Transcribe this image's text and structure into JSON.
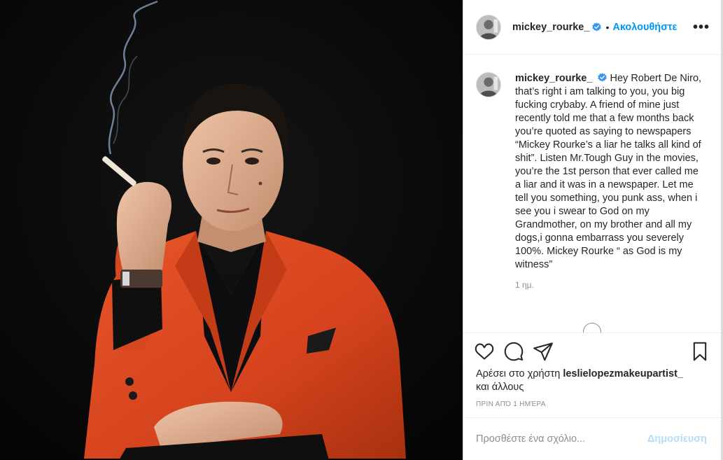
{
  "header": {
    "username": "mickey_rourke_",
    "separator": "•",
    "follow_label": "Ακολουθήστε",
    "more_label": "•••"
  },
  "caption": {
    "username": "mickey_rourke_",
    "text": "Hey Robert De Niro, that’s right i am talking to you, you big fucking crybaby. A friend of mine just recently told me that a few months back you’re quoted as saying to newspapers “Mickey Rourke’s a liar he talks all kind of shit”. Listen Mr.Tough Guy in the movies, you’re the 1st person that ever called me a liar and it was in a newspaper. Let me tell you something, you punk ass, when i see you i swear to God on my Grandmother, on my brother and all my dogs,i gonna embarrass you severely 100%. Mickey Rourke “ as God is my witness”",
    "time": "1 ημ."
  },
  "likes": {
    "prefix": "Αρέσει στο χρήστη",
    "user": "leslielopezmakeupartist_",
    "suffix": "και άλλους"
  },
  "timestamp": "Πριν από 1 ημέρα",
  "comment": {
    "placeholder": "Προσθέστε ένα σχόλιο...",
    "post_label": "Δημοσίευση"
  },
  "icons": {
    "like": "heart-icon",
    "comment": "comment-icon",
    "share": "share-icon",
    "save": "bookmark-icon",
    "verified": "verified-badge-icon"
  },
  "colors": {
    "accent": "#0095f6",
    "verified": "#3897f0",
    "post_disabled": "#b2dffc",
    "jacket": "#d8461f"
  }
}
